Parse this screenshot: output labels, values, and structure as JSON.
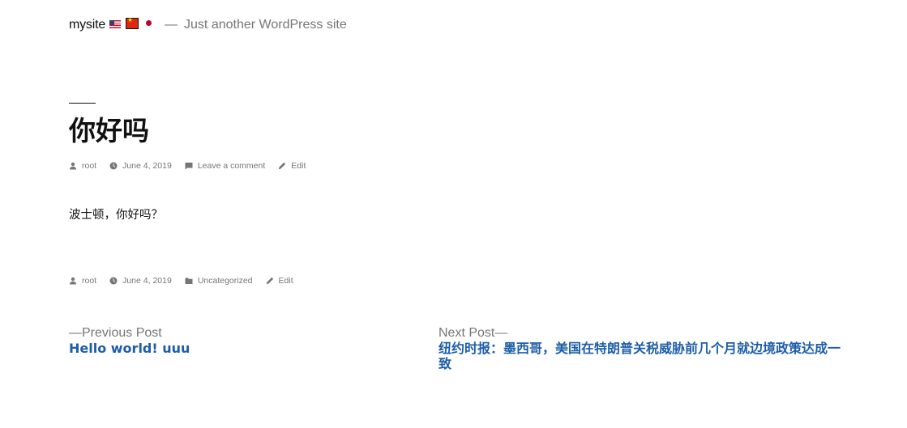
{
  "site": {
    "title": "mysite",
    "separator": "—",
    "tagline": "Just another WordPress site",
    "flags": [
      "us-flag-icon",
      "china-flag-icon",
      "japan-flag-icon"
    ]
  },
  "post": {
    "title": "你好吗",
    "content": "波士顿，你好吗？"
  },
  "meta_top": {
    "author": "root",
    "date": "June 4, 2019",
    "comments": "Leave a comment",
    "edit": "Edit"
  },
  "meta_bottom": {
    "author": "root",
    "date": "June 4, 2019",
    "category": "Uncategorized",
    "edit": "Edit"
  },
  "nav": {
    "previous_label": "—Previous Post",
    "previous_title": "Hello world! uuu",
    "next_label": "Next Post—",
    "next_title": "纽约时报：墨西哥，美国在特朗普关税威胁前几个月就边境政策达成一致"
  },
  "colors": {
    "text": "#111111",
    "muted": "#767676",
    "link": "#1e5ea8"
  }
}
